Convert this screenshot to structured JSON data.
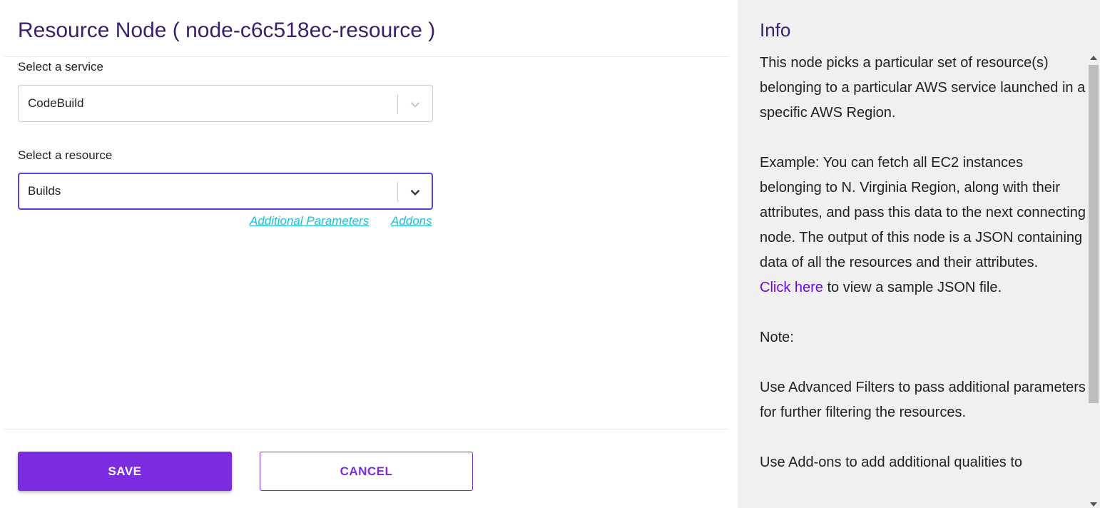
{
  "header": {
    "title": "Resource Node ( node-c6c518ec-resource )"
  },
  "service": {
    "label": "Select a service",
    "value": "CodeBuild"
  },
  "resource": {
    "label": "Select a resource",
    "value": "Builds"
  },
  "links": {
    "additional_parameters": "Additional Parameters",
    "addons": "Addons"
  },
  "actions": {
    "save": "SAVE",
    "cancel": "CANCEL"
  },
  "info": {
    "title": "Info",
    "p1": "This node picks a particular set of resource(s) belonging to a particular AWS service launched in a specific AWS Region.",
    "p2": "Example: You can fetch all EC2 instances belonging to N. Virginia Region, along with their attributes, and pass this data to the next connecting node. The output of this node is a JSON containing data of all the resources and their attributes.",
    "link_text": "Click here",
    "link_suffix": " to view a sample JSON file.",
    "note": "Note:",
    "p3": "Use Advanced Filters to pass additional parameters for further filtering the resources.",
    "p4": "Use Add-ons to add additional qualities to"
  },
  "icons": {
    "dropdown": "chevron-down-icon",
    "scroll_up": "arrow-up-icon",
    "scroll_down": "arrow-down-icon"
  },
  "colors": {
    "accent": "#7b2be0",
    "title": "#3b1e6e",
    "link": "#19c1d8",
    "focus": "#5046e5",
    "info_link": "#6a0ad6"
  }
}
